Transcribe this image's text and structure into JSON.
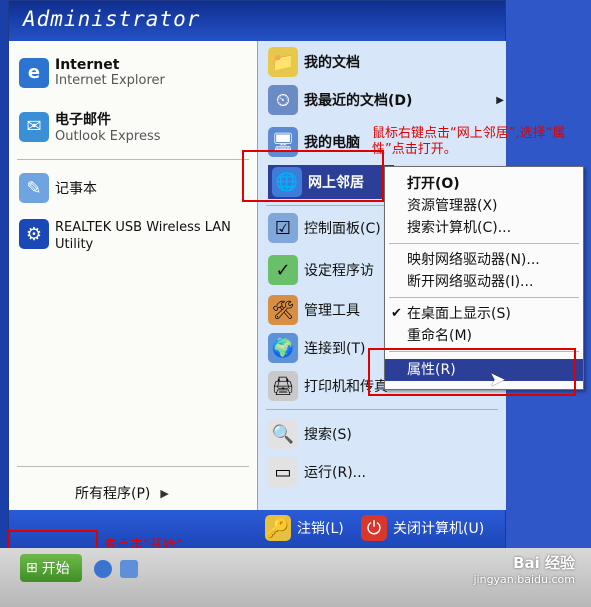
{
  "header": {
    "user_name": "Administrator"
  },
  "left_panel": {
    "pinned": [
      {
        "title": "Internet",
        "subtitle": "Internet Explorer",
        "icon": "internet-explorer-icon"
      },
      {
        "title": "电子邮件",
        "subtitle": "Outlook Express",
        "icon": "outlook-express-icon"
      }
    ],
    "recent": [
      {
        "label": "记事本",
        "icon": "notepad-icon"
      },
      {
        "label": "REALTEK USB Wireless LAN Utility",
        "icon": "realtek-utility-icon"
      }
    ],
    "all_programs": "所有程序(P)"
  },
  "right_panel": {
    "items": [
      {
        "label": "我的文档"
      },
      {
        "label": "我最近的文档(D)"
      },
      {
        "label": "我的电脑"
      },
      {
        "label": "网上邻居"
      },
      {
        "label": "控制面板(C)"
      },
      {
        "label": "设定程序访"
      },
      {
        "label": "管理工具"
      },
      {
        "label": "连接到(T)"
      },
      {
        "label": "打印机和传真"
      },
      {
        "label": "搜索(S)"
      },
      {
        "label": "运行(R)..."
      }
    ]
  },
  "context_menu": {
    "items": [
      {
        "label": "打开(O)"
      },
      {
        "label": "资源管理器(X)"
      },
      {
        "label": "搜索计算机(C)..."
      },
      {
        "label": "映射网络驱动器(N)..."
      },
      {
        "label": "断开网络驱动器(I)..."
      },
      {
        "label": "在桌面上显示(S)"
      },
      {
        "label": "重命名(M)"
      },
      {
        "label": "属性(R)"
      }
    ]
  },
  "footer": {
    "logoff": "注销(L)",
    "shutdown": "关闭计算机(U)"
  },
  "taskbar": {
    "start": "开始"
  },
  "annotations": {
    "right_click_tip": "鼠标右键点击“网上邻居”,选择“属性”点击打开。",
    "start_tip": "先点击“开始”"
  },
  "watermark": {
    "brand": "Bai 经验",
    "url": "jingyan.baidu.com"
  },
  "colors": {
    "header": "#1f48c1",
    "highlight": "#2b3f98",
    "annotation": "#e10000"
  }
}
